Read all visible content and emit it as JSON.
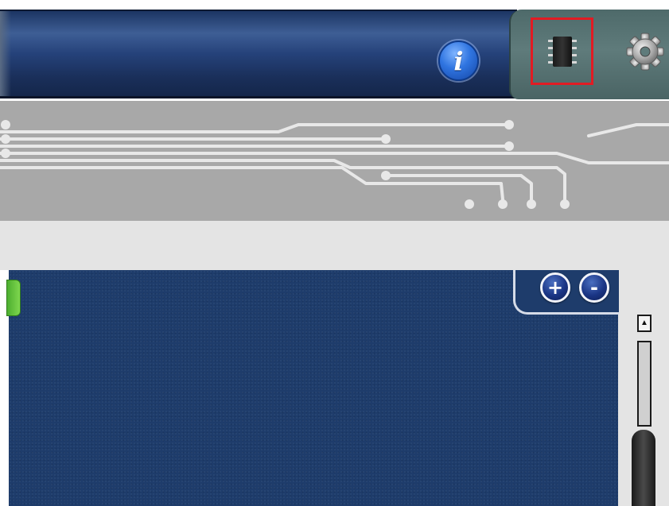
{
  "header": {
    "info_button_glyph": "i",
    "info_icon": "info-icon"
  },
  "toolbar": {
    "chip_icon": "ic-chip-icon",
    "chip_selected": true,
    "gear_icon": "gear-icon"
  },
  "circuit_banner": {
    "icon": "circuit-traces"
  },
  "workspace": {
    "zoom_in_glyph": "+",
    "zoom_out_glyph": "-"
  },
  "scrollbar": {
    "up_arrow_glyph": "▲"
  },
  "colors": {
    "header_blue": "#25427a",
    "tool_panel_teal": "#5f7b7b",
    "selection_red": "#e21b23",
    "circuit_grey": "#a8a8a8",
    "trace_white": "#e8e8e8",
    "workspace_navy": "#1e3c6b",
    "info_blue": "#2f74e0",
    "handle_green": "#5cbf3a"
  }
}
